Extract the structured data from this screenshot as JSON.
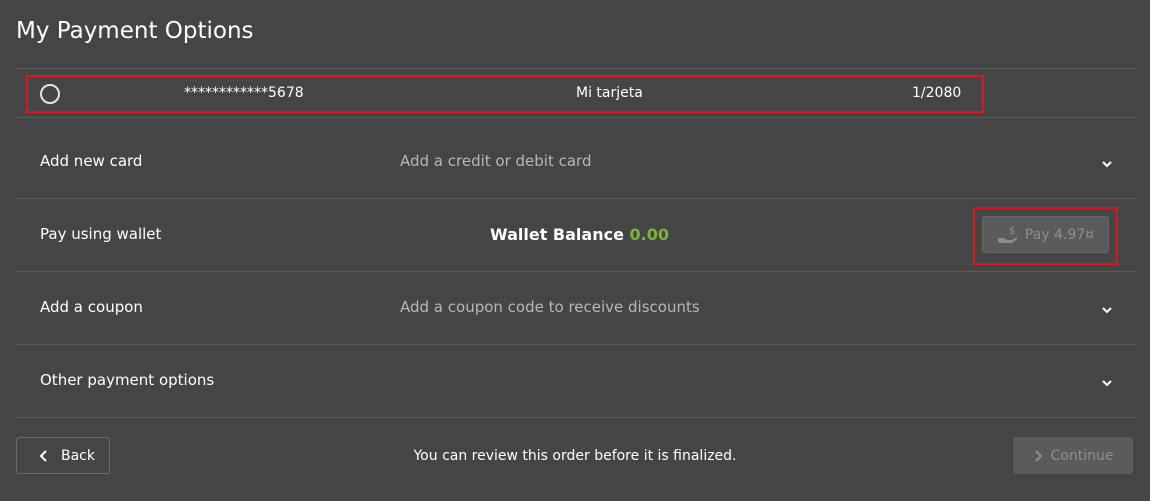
{
  "page": {
    "title": "My Payment Options"
  },
  "saved_card": {
    "number": "************5678",
    "name": "Mi tarjeta",
    "expiry": "1/2080"
  },
  "add_card": {
    "label": "Add new card",
    "description": "Add a credit or debit card"
  },
  "wallet": {
    "label": "Pay using wallet",
    "balance_label": "Wallet Balance",
    "balance_value": "0.00",
    "pay_button_label": "Pay 4.97¤"
  },
  "coupon": {
    "label": "Add a coupon",
    "description": "Add a coupon code to receive discounts"
  },
  "other": {
    "label": "Other payment options"
  },
  "footer": {
    "back_label": "Back",
    "note": "You can review this order before it is finalized.",
    "continue_label": "Continue"
  },
  "colors": {
    "background": "#454545",
    "highlight_border": "#e0161f",
    "balance_green": "#7fb23a"
  },
  "icons": {
    "chevron": "chevron-down-icon",
    "pay": "hand-dollar-icon",
    "back": "chevron-left-icon",
    "continue": "chevron-right-icon"
  }
}
